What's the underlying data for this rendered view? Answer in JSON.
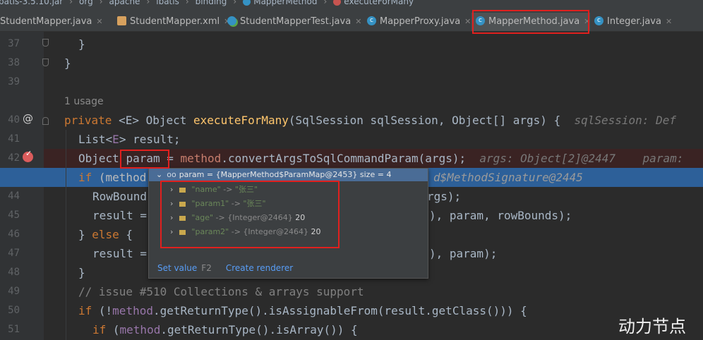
{
  "breadcrumb": [
    "batis-3.5.10.jar",
    "org",
    "apache",
    "ibatis",
    "binding",
    "MapperMethod",
    "executeForMany"
  ],
  "tabs": [
    {
      "label": "StudentMapper.java"
    },
    {
      "label": "StudentMapper.xml"
    },
    {
      "label": "StudentMapperTest.java"
    },
    {
      "label": "MapperProxy.java"
    },
    {
      "label": "MapperMethod.java"
    },
    {
      "label": "Integer.java"
    }
  ],
  "line_numbers": [
    "37",
    "38",
    "39",
    "40",
    "41",
    "42",
    "43",
    "44",
    "45",
    "46",
    "47",
    "48",
    "49",
    "50",
    "51"
  ],
  "usage": "1 usage",
  "code": {
    "l37": "}",
    "l38": "}",
    "l40_kw": "private",
    "l40_a": " <E> Object ",
    "l40_fn": "executeForMany",
    "l40_b": "(SqlSession sqlSession, Object[] args) {",
    "l40_hint": "sqlSession: Def",
    "l41_a": "List<",
    "l41_b": "E",
    "l41_c": "> result;",
    "l42_a": "Object ",
    "l42_param": "param",
    "l42_b": " = ",
    "l42_fld": "method",
    "l42_c": ".convertArgsToSqlCommandParam(args);",
    "l42_hint": "args: Object[2]@2447    param:",
    "l43_kw": "if",
    "l43_a": " (method",
    "l43_b": "d$MethodSignature@2445",
    "l44_a": "RowBound",
    "l44_b": "rgs);",
    "l45_a": "result =",
    "l45_b": "), param, rowBounds);",
    "l46_a": "} ",
    "l46_kw": "else",
    "l46_b": " {",
    "l47_a": "result =",
    "l47_b": "), param);",
    "l48": "}",
    "l49": "// issue #510 Collections & arrays support",
    "l50_kw": "if",
    "l50_a": " (!",
    "l50_fld": "method",
    "l50_b": ".getReturnType().isAssignableFrom(result.getClass())) {",
    "l51_kw": "if",
    "l51_a": " (",
    "l51_fld": "method",
    "l51_b": ".getReturnType().isArray()) {"
  },
  "popup": {
    "header": "param = {MapperMethod$ParamMap@2453}  size = 4",
    "entries": [
      {
        "key": "\"name\"",
        "arrow": " -> ",
        "value": "\"张三\""
      },
      {
        "key": "\"param1\"",
        "arrow": " -> ",
        "value": "\"张三\""
      },
      {
        "key": "\"age\"",
        "arrow": " -> ",
        "ref": "{Integer@2464}",
        "num": "20"
      },
      {
        "key": "\"param2\"",
        "arrow": " -> ",
        "ref": "{Integer@2464}",
        "num": "20"
      }
    ],
    "set_value": "Set value",
    "set_value_shortcut": "F2",
    "create_renderer": "Create renderer"
  },
  "watermark": "动力节点",
  "colors": {
    "accent_red": "#e0201e",
    "keyword": "#cc7832",
    "method_name": "#ffc66d",
    "field": "#9876aa",
    "string": "#6a8759"
  }
}
